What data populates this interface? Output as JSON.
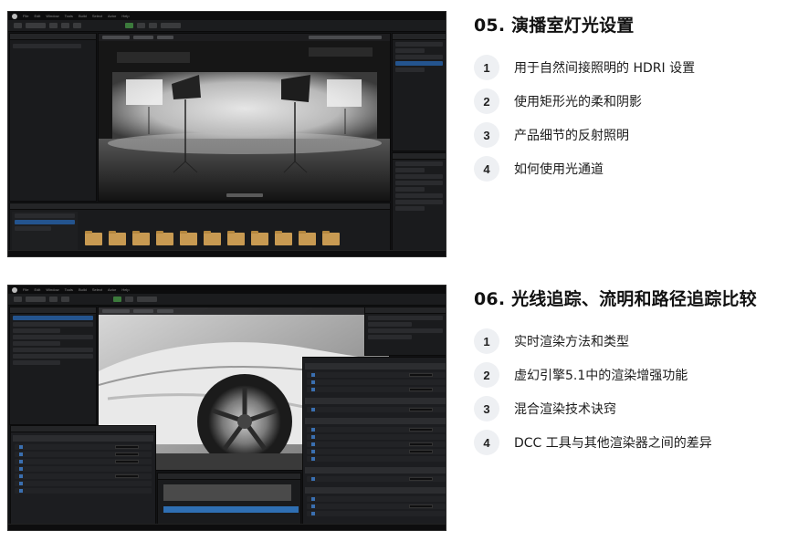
{
  "section1": {
    "title": "05. 演播室灯光设置",
    "items": [
      {
        "num": "1",
        "label": "用于自然间接照明的 HDRI 设置"
      },
      {
        "num": "2",
        "label": "使用矩形光的柔和阴影"
      },
      {
        "num": "3",
        "label": "产品细节的反射照明"
      },
      {
        "num": "4",
        "label": "如何使用光通道"
      }
    ],
    "screenshot": {
      "viewport": "studio-lighting-scene",
      "menu": [
        "File",
        "Edit",
        "Window",
        "Tools",
        "Build",
        "Select",
        "Actor",
        "Help"
      ],
      "colors": {
        "folder": "#c89a52",
        "selection": "#24548e"
      }
    }
  },
  "section2": {
    "title": "06. 光线追踪、流明和路径追踪比较",
    "items": [
      {
        "num": "1",
        "label": "实时渲染方法和类型"
      },
      {
        "num": "2",
        "label": "虚幻引擎5.1中的渲染增强功能"
      },
      {
        "num": "3",
        "label": "混合渲染技术诀窍"
      },
      {
        "num": "4",
        "label": "DCC 工具与其他渲染器之间的差异"
      }
    ],
    "screenshot": {
      "viewport": "car-wheel-render-scene",
      "menu": [
        "File",
        "Edit",
        "Window",
        "Tools",
        "Build",
        "Select",
        "Actor",
        "Help"
      ],
      "colors": {
        "timeline": "#2f6fb3",
        "checkbox": "#3a6fb0"
      }
    }
  }
}
